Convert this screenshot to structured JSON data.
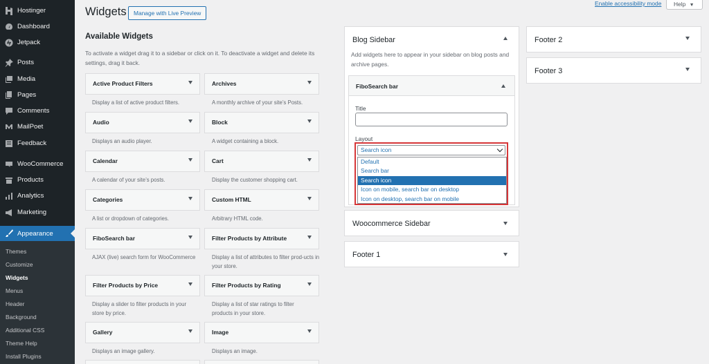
{
  "sidebar": {
    "items": [
      {
        "label": "Hostinger",
        "icon": "hostinger-icon"
      },
      {
        "label": "Dashboard",
        "icon": "dashboard-icon"
      },
      {
        "label": "Jetpack",
        "icon": "jetpack-icon"
      },
      {
        "label": "Posts",
        "icon": "pin-icon"
      },
      {
        "label": "Media",
        "icon": "media-icon"
      },
      {
        "label": "Pages",
        "icon": "pages-icon"
      },
      {
        "label": "Comments",
        "icon": "comment-icon"
      },
      {
        "label": "MailPoet",
        "icon": "mailpoet-icon"
      },
      {
        "label": "Feedback",
        "icon": "feedback-icon"
      },
      {
        "label": "WooCommerce",
        "icon": "woocommerce-icon"
      },
      {
        "label": "Products",
        "icon": "products-icon"
      },
      {
        "label": "Analytics",
        "icon": "analytics-icon"
      },
      {
        "label": "Marketing",
        "icon": "marketing-icon"
      },
      {
        "label": "Appearance",
        "icon": "paintbrush-icon"
      }
    ],
    "submenu": [
      "Themes",
      "Customize",
      "Widgets",
      "Menus",
      "Header",
      "Background",
      "Additional CSS",
      "Theme Help",
      "Install Plugins"
    ],
    "accent_color": "#2271b1"
  },
  "header": {
    "title": "Widgets",
    "live_preview": "Manage with Live Preview",
    "accessibility": "Enable accessibility mode",
    "help": "Help"
  },
  "available": {
    "title": "Available Widgets",
    "description": "To activate a widget drag it to a sidebar or click on it. To deactivate a widget and delete its settings, drag it back.",
    "widgets": [
      {
        "title": "Active Product Filters",
        "desc": "Display a list of active product filters."
      },
      {
        "title": "Archives",
        "desc": "A monthly archive of your site’s Posts."
      },
      {
        "title": "Audio",
        "desc": "Displays an audio player."
      },
      {
        "title": "Block",
        "desc": "A widget containing a block."
      },
      {
        "title": "Calendar",
        "desc": "A calendar of your site’s posts."
      },
      {
        "title": "Cart",
        "desc": "Display the customer shopping cart."
      },
      {
        "title": "Categories",
        "desc": "A list or dropdown of categories."
      },
      {
        "title": "Custom HTML",
        "desc": "Arbitrary HTML code."
      },
      {
        "title": "FiboSearch bar",
        "desc": "AJAX (live) search form for WooCommerce"
      },
      {
        "title": "Filter Products by Attribute",
        "desc": "Display a list of attributes to filter prod-ucts in your store."
      },
      {
        "title": "Filter Products by Price",
        "desc": "Display a slider to filter products in your store by price."
      },
      {
        "title": "Filter Products by Rating",
        "desc": "Display a list of star ratings to filter products in your store."
      },
      {
        "title": "Gallery",
        "desc": "Displays an image gallery."
      },
      {
        "title": "Image",
        "desc": "Displays an image."
      }
    ]
  },
  "areas": {
    "blog_sidebar": {
      "title": "Blog Sidebar",
      "description": "Add widgets here to appear in your sidebar on blog posts and archive pages."
    },
    "fibosearch": {
      "title": "FiboSearch bar",
      "title_label": "Title",
      "title_value": "",
      "layout_label": "Layout",
      "selected": "Search icon",
      "options": [
        "Default",
        "Search bar",
        "Search icon",
        "Icon on mobile, search bar on desktop",
        "Icon on desktop, search bar on mobile"
      ]
    },
    "woocommerce_sidebar": "Woocommerce Sidebar",
    "footer1": "Footer 1",
    "footer2": "Footer 2",
    "footer3": "Footer 3"
  },
  "highlight_color": "#d63638"
}
